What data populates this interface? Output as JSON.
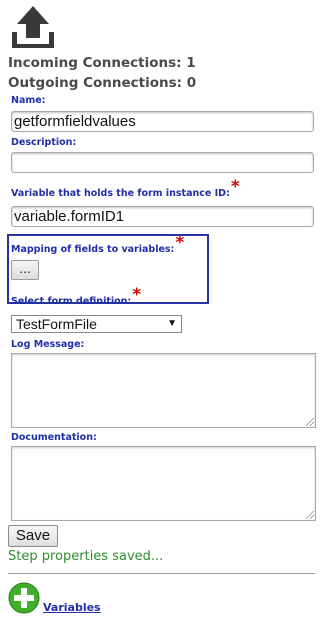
{
  "connections": {
    "incoming": "Incoming Connections: 1",
    "outgoing": "Outgoing Connections: 0"
  },
  "form": {
    "name": {
      "label": "Name:",
      "value": "getformfieldvalues"
    },
    "description": {
      "label": "Description:",
      "value": ""
    },
    "instance_var": {
      "label": "Variable that holds the form instance ID:",
      "value": "variable.formID1",
      "required_mark": "*"
    },
    "mapping": {
      "label": "Mapping of fields to variables:",
      "button_label": "...",
      "required_mark": "*"
    },
    "form_definition": {
      "label": "Select form definition:",
      "selected": "TestFormFile",
      "required_mark": "*"
    },
    "log_message": {
      "label": "Log Message:",
      "value": ""
    },
    "documentation": {
      "label": "Documentation:",
      "value": ""
    }
  },
  "actions": {
    "save_label": "Save",
    "status": "Step properties saved..."
  },
  "footer": {
    "variables_link": "Variables"
  },
  "colors": {
    "label": "#1f2fa6",
    "required": "#e00000",
    "status": "#2e8b2e",
    "highlight_border": "#2a33a0",
    "add_icon": "#3fae29"
  },
  "icons": {
    "export": "upload-tray-icon",
    "add": "plus-circle-icon"
  }
}
